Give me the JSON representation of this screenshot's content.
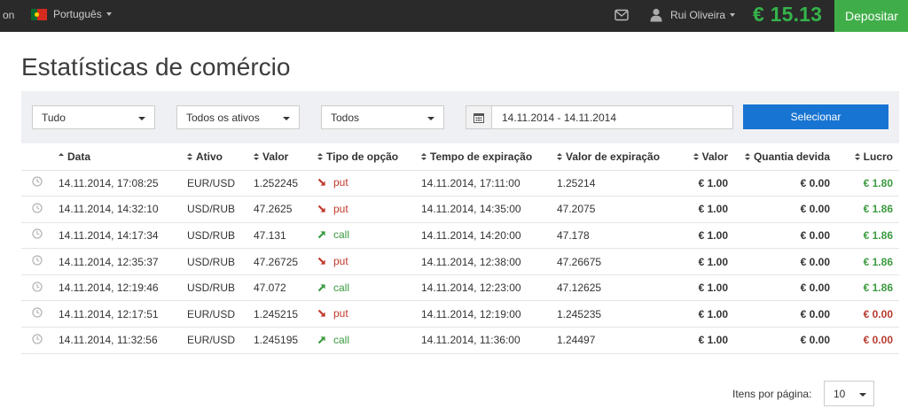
{
  "topbar": {
    "edge_text": "on",
    "language": "Português",
    "user_name": "Rui Oliveira",
    "balance": "€ 15.13",
    "deposit_label": "Depositar"
  },
  "page": {
    "title": "Estatísticas de comércio"
  },
  "filters": {
    "type_value": "Tudo",
    "asset_value": "Todos os ativos",
    "status_value": "Todos",
    "date_range": "14.11.2014 - 14.11.2014",
    "submit_label": "Selecionar"
  },
  "table": {
    "headers": {
      "date": "Data",
      "asset": "Ativo",
      "value": "Valor",
      "option_type": "Tipo de opção",
      "expiry_time": "Tempo de expiração",
      "expiry_value": "Valor de expiração",
      "amount": "Valor",
      "owed": "Quantia devida",
      "profit": "Lucro"
    },
    "rows": [
      {
        "date": "14.11.2014, 17:08:25",
        "asset": "EUR/USD",
        "value": "1.252245",
        "type": "put",
        "expiry_time": "14.11.2014, 17:11:00",
        "expiry_value": "1.25214",
        "amount": "€ 1.00",
        "owed": "€ 0.00",
        "profit": "€ 1.80",
        "profit_color": "#3a9a3f"
      },
      {
        "date": "14.11.2014, 14:32:10",
        "asset": "USD/RUB",
        "value": "47.2625",
        "type": "put",
        "expiry_time": "14.11.2014, 14:35:00",
        "expiry_value": "47.2075",
        "amount": "€ 1.00",
        "owed": "€ 0.00",
        "profit": "€ 1.86",
        "profit_color": "#3a9a3f"
      },
      {
        "date": "14.11.2014, 14:17:34",
        "asset": "USD/RUB",
        "value": "47.131",
        "type": "call",
        "expiry_time": "14.11.2014, 14:20:00",
        "expiry_value": "47.178",
        "amount": "€ 1.00",
        "owed": "€ 0.00",
        "profit": "€ 1.86",
        "profit_color": "#3a9a3f"
      },
      {
        "date": "14.11.2014, 12:35:37",
        "asset": "USD/RUB",
        "value": "47.26725",
        "type": "put",
        "expiry_time": "14.11.2014, 12:38:00",
        "expiry_value": "47.26675",
        "amount": "€ 1.00",
        "owed": "€ 0.00",
        "profit": "€ 1.86",
        "profit_color": "#3a9a3f"
      },
      {
        "date": "14.11.2014, 12:19:46",
        "asset": "USD/RUB",
        "value": "47.072",
        "type": "call",
        "expiry_time": "14.11.2014, 12:23:00",
        "expiry_value": "47.12625",
        "amount": "€ 1.00",
        "owed": "€ 0.00",
        "profit": "€ 1.86",
        "profit_color": "#3a9a3f"
      },
      {
        "date": "14.11.2014, 12:17:51",
        "asset": "EUR/USD",
        "value": "1.245215",
        "type": "put",
        "expiry_time": "14.11.2014, 12:19:00",
        "expiry_value": "1.245235",
        "amount": "€ 1.00",
        "owed": "€ 0.00",
        "profit": "€ 0.00",
        "profit_color": "#b83a2e"
      },
      {
        "date": "14.11.2014, 11:32:56",
        "asset": "EUR/USD",
        "value": "1.245195",
        "type": "call",
        "expiry_time": "14.11.2014, 11:36:00",
        "expiry_value": "1.24497",
        "amount": "€ 1.00",
        "owed": "€ 0.00",
        "profit": "€ 0.00",
        "profit_color": "#b83a2e"
      }
    ]
  },
  "pagination": {
    "per_page_label": "Itens por página:",
    "per_page_value": "10"
  },
  "colors": {
    "topbar": "#2a2a2a",
    "balance": "#35b34a",
    "deposit": "#3fae49",
    "select_button": "#1874d2",
    "put_arrow": "#c0392b",
    "call_arrow": "#3a9a3f"
  },
  "icons": {
    "flag": "portugal-flag-icon",
    "mail": "envelope-icon",
    "user": "user-icon",
    "calendar": "calendar-icon",
    "row": "clock-icon",
    "put": "arrow-down-right-icon",
    "call": "arrow-up-right-icon"
  }
}
